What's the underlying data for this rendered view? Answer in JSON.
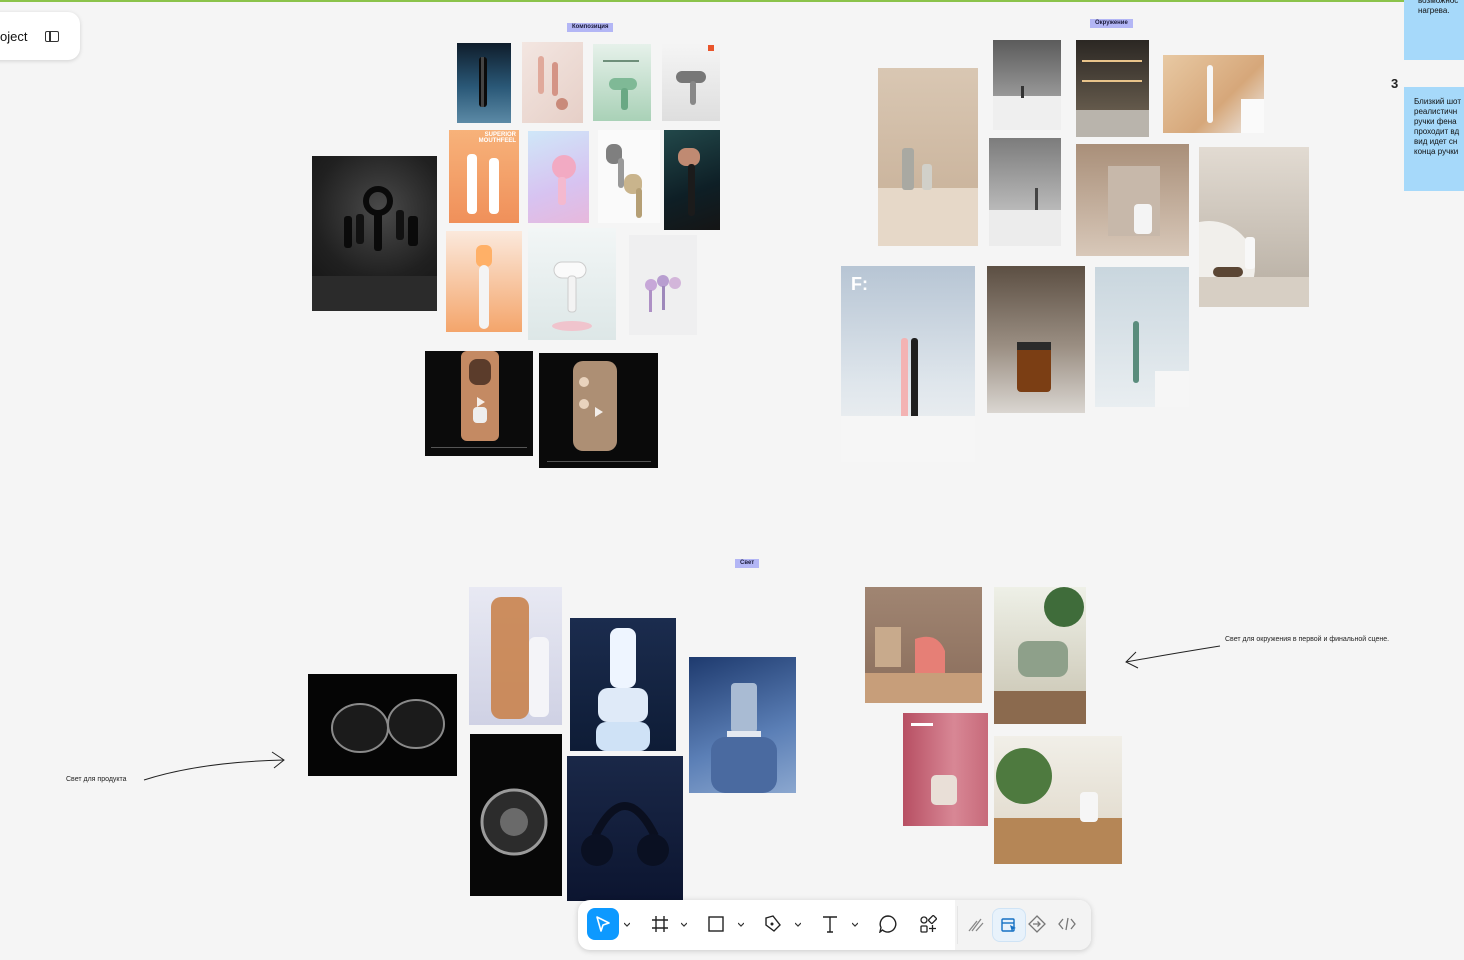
{
  "header": {
    "project_label": "oject"
  },
  "sections": {
    "composition": "Композиция",
    "environment": "Окружение",
    "light": "Свет"
  },
  "notes": {
    "product_light": "Свет для продукта",
    "env_light": "Свет для окружения в первой и финальной сцене."
  },
  "sticky": {
    "top_text": "возможнос\nнагрева.",
    "number": "3",
    "second_text": "Близкий шот\nреалистичн\nручки фена\nпроходит вд\nвид идет сн\nконца ручки"
  },
  "posters": {
    "superior": "SUPERIOR\nMOUTHFEEL",
    "fletter": "F:"
  },
  "toolbar": {
    "tools": [
      "move",
      "frame",
      "shape",
      "pen",
      "text",
      "comment",
      "actions",
      "draw",
      "design",
      "prototype",
      "dev"
    ]
  },
  "colors": {
    "accent": "#0d99ff",
    "label_bg": "#b3b6f5",
    "sticky_bg": "#a6d9fa"
  }
}
